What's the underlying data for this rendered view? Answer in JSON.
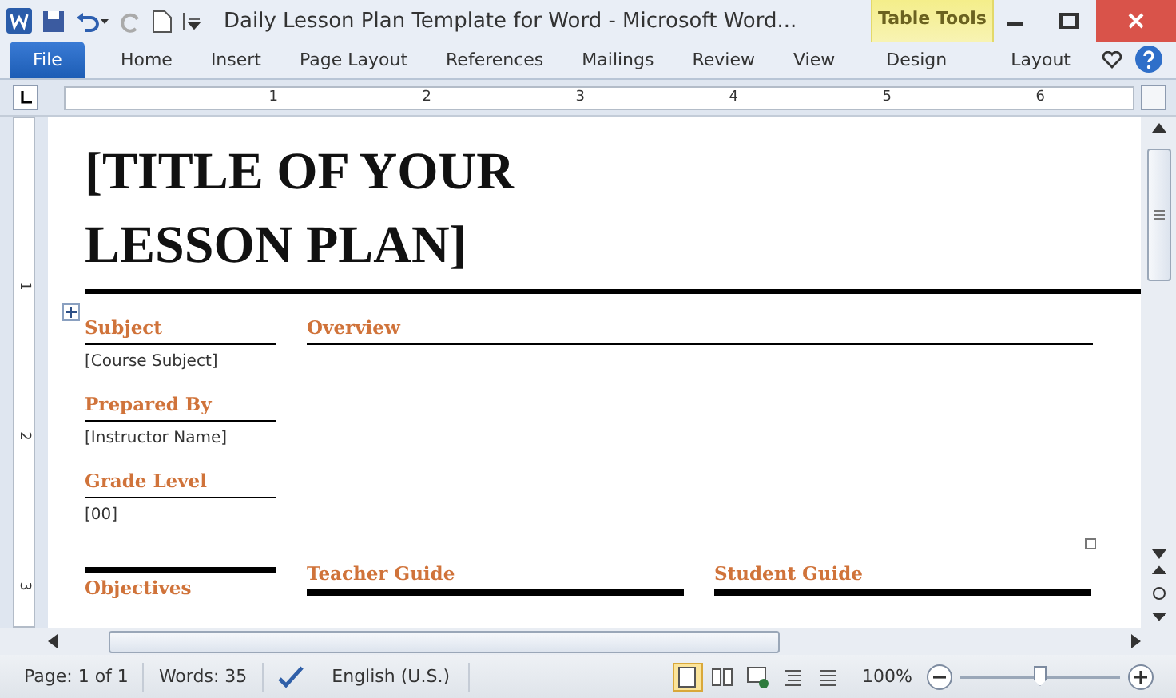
{
  "title_bar": {
    "title": "Daily Lesson Plan Template for Word  -  Microsoft Word...",
    "contextual_tab": "Table Tools"
  },
  "ribbon_tabs": [
    {
      "label": "File",
      "kind": "file",
      "selected": false
    },
    {
      "label": "Home",
      "kind": "normal",
      "selected": false
    },
    {
      "label": "Insert",
      "kind": "normal",
      "selected": false
    },
    {
      "label": "Page Layout",
      "kind": "normal",
      "selected": false
    },
    {
      "label": "References",
      "kind": "normal",
      "selected": false
    },
    {
      "label": "Mailings",
      "kind": "normal",
      "selected": false
    },
    {
      "label": "Review",
      "kind": "normal",
      "selected": false
    },
    {
      "label": "View",
      "kind": "normal",
      "selected": false
    },
    {
      "label": "Design",
      "kind": "contextual",
      "selected": false
    },
    {
      "label": "Layout",
      "kind": "contextual",
      "selected": false
    }
  ],
  "ruler": {
    "numbers": [
      "1",
      "2",
      "3",
      "4",
      "5",
      "6"
    ],
    "vertical_numbers": [
      "1",
      "2",
      "3"
    ]
  },
  "document": {
    "title": "[TITLE OF YOUR LESSON PLAN]",
    "fields": [
      {
        "label": "Subject",
        "value": "[Course Subject]"
      },
      {
        "label": "Prepared By",
        "value": "[Instructor Name]"
      },
      {
        "label": "Grade Level",
        "value": "[00]"
      }
    ],
    "overview_heading": "Overview",
    "guides": [
      "Teacher Guide",
      "Student Guide"
    ],
    "objectives_heading": "Objectives"
  },
  "status_bar": {
    "page": "Page: 1 of 1",
    "words": "Words: 35",
    "language": "English (U.S.)",
    "zoom": "100%",
    "level": 0.5,
    "views": [
      {
        "kind": "print",
        "selected": true
      },
      {
        "kind": "reading",
        "selected": false
      },
      {
        "kind": "web",
        "selected": false
      },
      {
        "kind": "outline",
        "selected": false
      },
      {
        "kind": "draft",
        "selected": false
      }
    ]
  }
}
